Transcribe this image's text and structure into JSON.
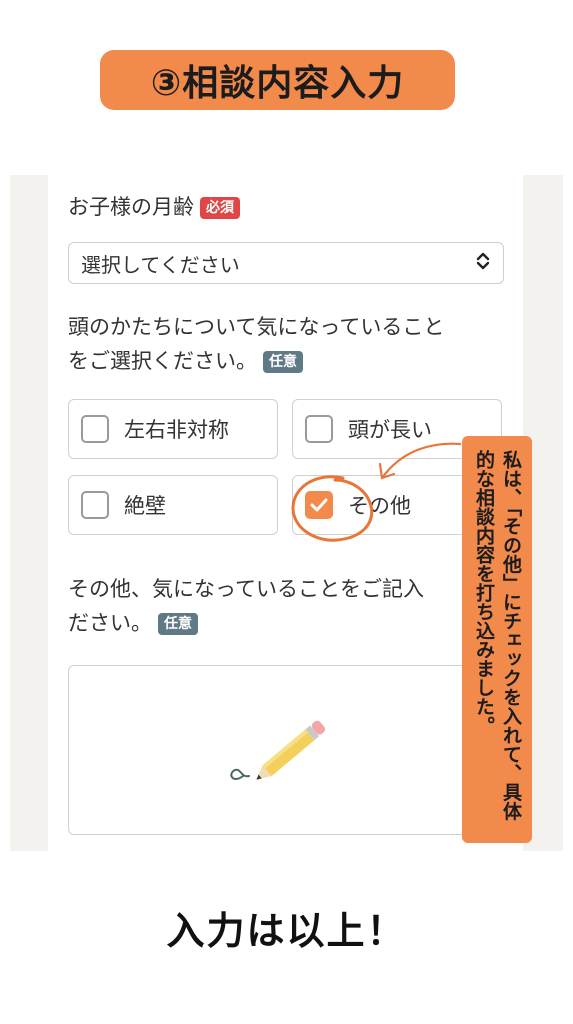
{
  "step_title": "③相談内容入力",
  "form": {
    "age_label": "お子様の月齢",
    "required_badge": "必須",
    "select_value": "選択してください",
    "concern_label_line1": "頭のかたちについて気になっていること",
    "concern_label_line2": "をご選択ください。",
    "optional_badge": "任意",
    "options": [
      {
        "label": "左右非対称",
        "checked": false
      },
      {
        "label": "頭が長い",
        "checked": false
      },
      {
        "label": "絶壁",
        "checked": false
      },
      {
        "label": "その他",
        "checked": true
      }
    ],
    "other_label_line1": "その他、気になっていることをご記入",
    "other_label_line2": "ださい。",
    "optional_badge2": "任意"
  },
  "callout": {
    "text": "私は、「その他」にチェックを入れて、具体的な相談内容を打ち込みました。"
  },
  "footer_text": "入力は以上！",
  "colors": {
    "accent": "#f28a4b",
    "required": "#e04646",
    "optional": "#5f7a86"
  },
  "icons": [
    "select-arrows-icon",
    "checkmark-icon",
    "pencil-icon",
    "curved-arrow-icon"
  ]
}
